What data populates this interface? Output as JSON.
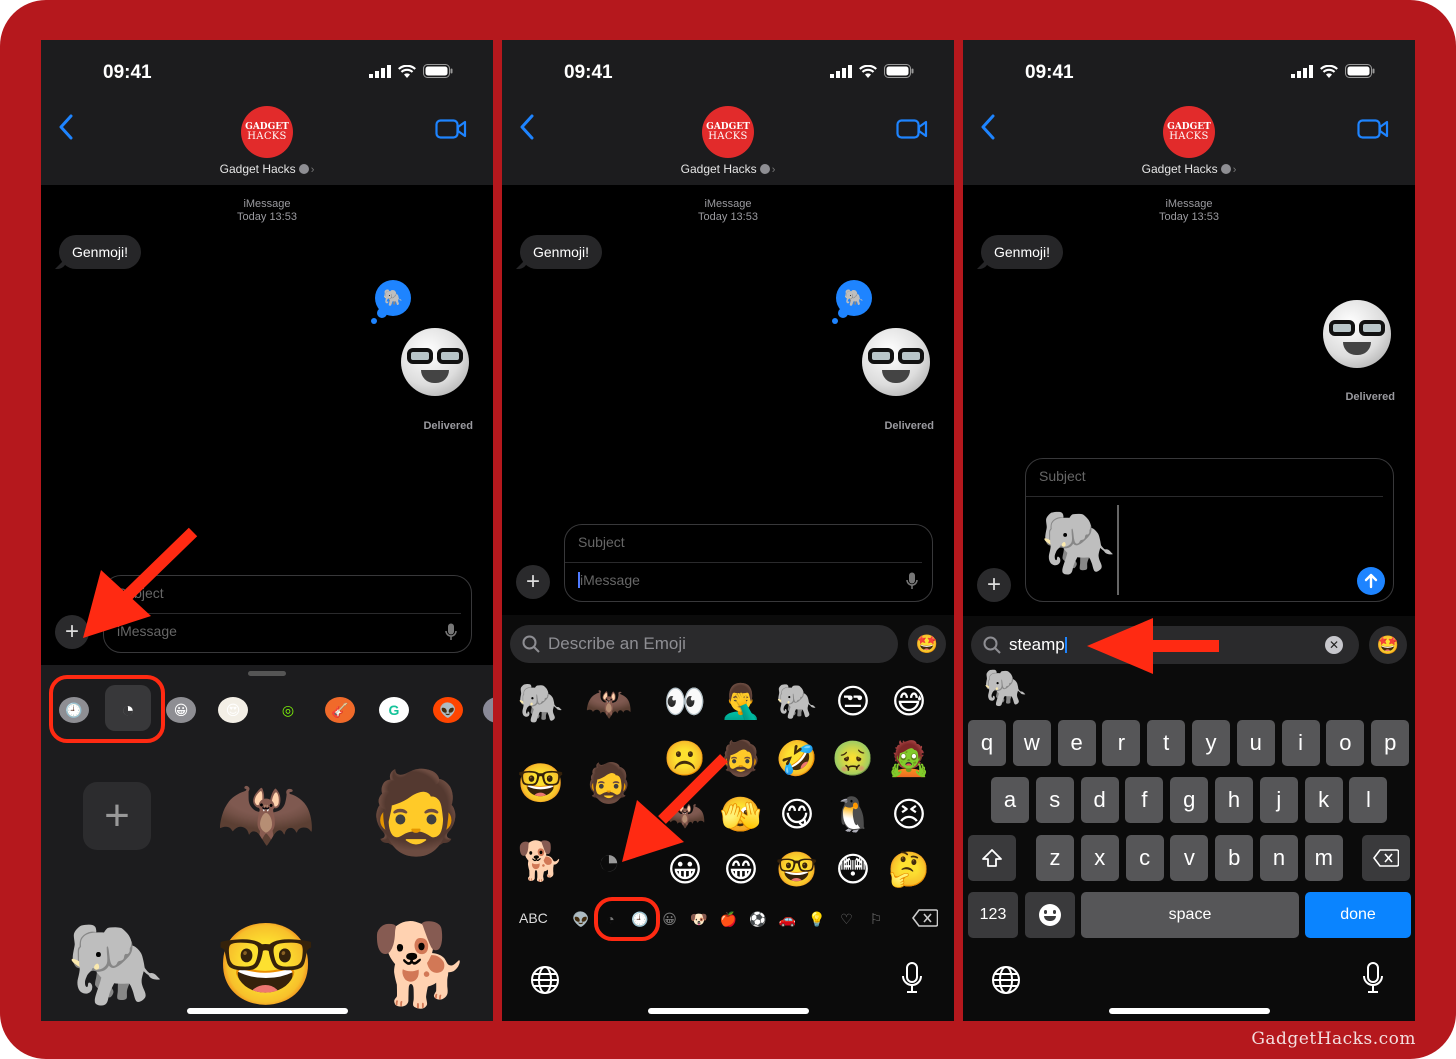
{
  "watermark": "GadgetHacks.com",
  "colors": {
    "frame": "#b5181d",
    "accent_blue": "#1e84ff",
    "annotation_red": "#ff2a12",
    "avatar_red": "#e22b2b"
  },
  "status": {
    "time": "09:41",
    "icons": [
      "signal-icon",
      "wifi-icon",
      "battery-icon"
    ]
  },
  "header": {
    "avatar_line1": "GADGET",
    "avatar_line2": "HACKS",
    "contact_name": "Gadget Hacks"
  },
  "conversation": {
    "service": "iMessage",
    "timestamp": "Today 13:53",
    "incoming_message": "Genmoji!",
    "tapback_emoji": "🐘",
    "sticker_emoji": "🤓",
    "delivered": "Delivered"
  },
  "compose": {
    "subject_placeholder": "Subject",
    "message_placeholder": "iMessage",
    "attached_sticker": "🐘"
  },
  "panel1": {
    "app_strip": [
      {
        "name": "recents-icon",
        "glyph": "🕘"
      },
      {
        "name": "stickers-icon",
        "glyph": "◔"
      },
      {
        "name": "emoji-icon",
        "glyph": "😀"
      },
      {
        "name": "memoji-app-icon",
        "glyph": "😍"
      },
      {
        "name": "fitness-app-icon",
        "glyph": "◎"
      },
      {
        "name": "garageband-app-icon",
        "glyph": "🎸"
      },
      {
        "name": "grammarly-app-icon",
        "glyph": "G"
      },
      {
        "name": "reddit-app-icon",
        "glyph": "👽"
      }
    ],
    "add_sticker_label": "+",
    "stickers": [
      {
        "name": "sticker-bat",
        "glyph": "🦇"
      },
      {
        "name": "sticker-memoji-face",
        "glyph": "🧔"
      },
      {
        "name": "sticker-elephant-clock-eyes",
        "glyph": "🐘"
      },
      {
        "name": "sticker-nerd-soccer-ball",
        "glyph": "🤓"
      },
      {
        "name": "sticker-dog-with-blanket",
        "glyph": "🐕"
      }
    ]
  },
  "panel2": {
    "search_placeholder": "Describe an Emoji",
    "recent_stickers": [
      "🐘",
      "🦇",
      "🤓",
      "🧔",
      "🐕",
      "◔"
    ],
    "emoji_grid": [
      [
        "👀",
        "🤦‍♂️",
        "🐘",
        "😒",
        "😅"
      ],
      [
        "☹️",
        "🧔",
        "🤣",
        "🤢",
        "🧟"
      ],
      [
        "🦇",
        "🫣",
        "😋",
        "🐧",
        "😣"
      ],
      [
        "😀",
        "😁",
        "🤓",
        "😳",
        "🤔"
      ]
    ],
    "abc_label": "ABC",
    "categories": [
      "👽",
      "◔",
      "🕘",
      "😀",
      "🐶",
      "🍎",
      "⚽",
      "🚗",
      "💡",
      "♡",
      "⚐"
    ]
  },
  "panel3": {
    "search_value": "steamp",
    "search_result": "🐘",
    "keyboard": {
      "row1": [
        "q",
        "w",
        "e",
        "r",
        "t",
        "y",
        "u",
        "i",
        "o",
        "p"
      ],
      "row2": [
        "a",
        "s",
        "d",
        "f",
        "g",
        "h",
        "j",
        "k",
        "l"
      ],
      "row3": [
        "z",
        "x",
        "c",
        "v",
        "b",
        "n",
        "m"
      ],
      "numbers_label": "123",
      "space_label": "space",
      "done_label": "done"
    }
  }
}
